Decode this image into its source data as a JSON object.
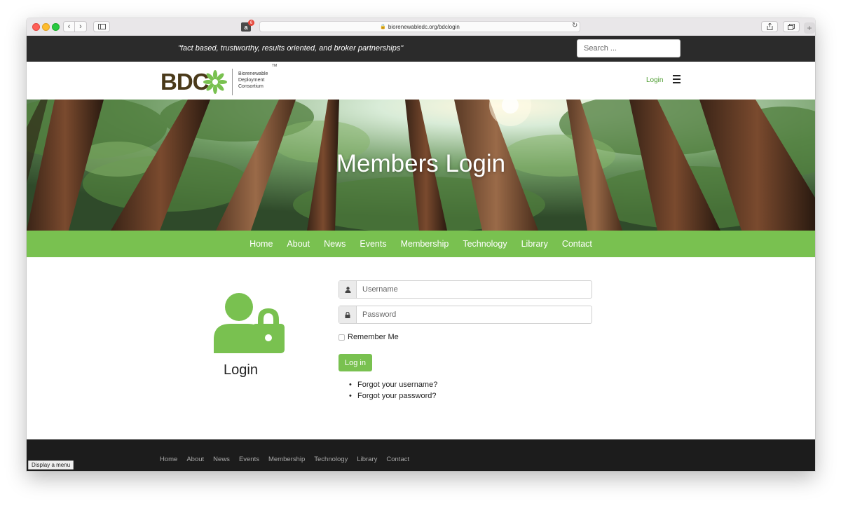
{
  "browser": {
    "url": "biorenewabledc.org/bdclogin",
    "extension_badge": "6"
  },
  "topbar": {
    "tagline": "\"fact based, trustworthy, results oriented, and broker partnerships\"",
    "search_placeholder": "Search ..."
  },
  "header": {
    "logo_letters": "BDC",
    "logo_line1": "Biorenewable",
    "logo_line2": "Deployment",
    "logo_line3": "Consortium",
    "logo_tm": "TM",
    "login_link": "Login"
  },
  "hero": {
    "title": "Members Login"
  },
  "nav": {
    "items": [
      "Home",
      "About",
      "News",
      "Events",
      "Membership",
      "Technology",
      "Library",
      "Contact"
    ]
  },
  "login": {
    "heading": "Login",
    "username_placeholder": "Username",
    "password_placeholder": "Password",
    "remember_label": "Remember Me",
    "submit_label": "Log in",
    "forgot_username": "Forgot your username?",
    "forgot_password": "Forgot your password?"
  },
  "footer": {
    "items": [
      "Home",
      "About",
      "News",
      "Events",
      "Membership",
      "Technology",
      "Library",
      "Contact"
    ]
  },
  "status": {
    "tooltip": "Display a menu"
  },
  "colors": {
    "brand_green": "#79c150",
    "dark_bar": "#2b2b2b",
    "footer": "#1c1c1c"
  }
}
